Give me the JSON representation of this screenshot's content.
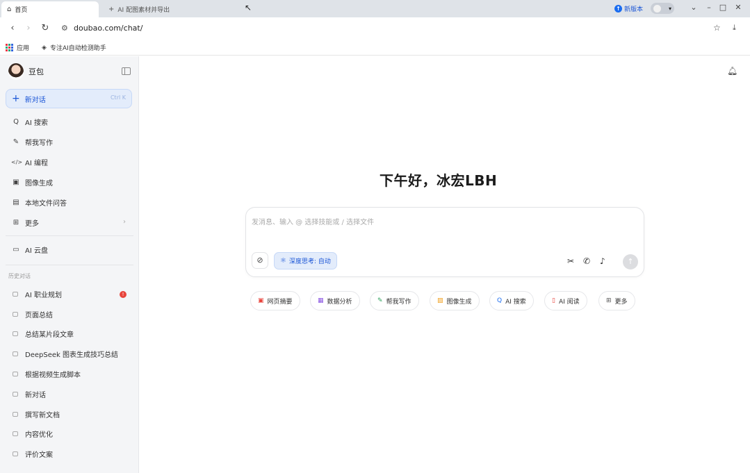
{
  "browser": {
    "active_tab": "首页",
    "inactive_tab": "AI 配图素材并导出",
    "new_version": "新版本",
    "url": "doubao.com/chat/",
    "bookmarks": [
      {
        "label": "应用"
      },
      {
        "label": "专注AI自动检测助手"
      }
    ]
  },
  "sidebar": {
    "brand": "豆包",
    "new_chat": {
      "label": "新对话",
      "shortcut": "Ctrl K"
    },
    "menu": [
      {
        "icon": "ai-search-icon",
        "glyph": "Q",
        "label": "AI 搜索"
      },
      {
        "icon": "write-icon",
        "glyph": "✎",
        "label": "帮我写作"
      },
      {
        "icon": "code-icon",
        "glyph": "</>",
        "label": "AI 编程"
      },
      {
        "icon": "image-gen-icon",
        "glyph": "▣",
        "label": "图像生成"
      },
      {
        "icon": "file-qa-icon",
        "glyph": "▤",
        "label": "本地文件问答"
      },
      {
        "icon": "more-icon",
        "glyph": "⊞",
        "label": "更多"
      }
    ],
    "cloud": {
      "icon": "cloud-drive-icon",
      "glyph": "▭",
      "label": "AI 云盘"
    },
    "history_title": "历史对话",
    "history": [
      {
        "label": "AI 职业规划",
        "badge": "!"
      },
      {
        "label": "页面总结"
      },
      {
        "label": "总结某片段文章"
      },
      {
        "label": "DeepSeek 图表生成技巧总结"
      },
      {
        "label": "根据视频生成脚本"
      },
      {
        "label": "新对话"
      },
      {
        "label": "撰写新文档"
      },
      {
        "label": "内容优化"
      },
      {
        "label": "评价文案"
      }
    ]
  },
  "main": {
    "greeting": "下午好，冰宏LBH",
    "composer": {
      "placeholder": "发消息、输入 @ 选择技能或 / 选择文件",
      "deep_think": "深度思考: 自动"
    },
    "chips": [
      {
        "label": "网页摘要",
        "icon": "web-summary-icon",
        "glyph": "▣",
        "color": "#e8443c"
      },
      {
        "label": "数据分析",
        "icon": "data-analysis-icon",
        "glyph": "▦",
        "color": "#8a56e2"
      },
      {
        "label": "帮我写作",
        "icon": "write-icon",
        "glyph": "✎",
        "color": "#2aa05a"
      },
      {
        "label": "图像生成",
        "icon": "image-gen-icon",
        "glyph": "▨",
        "color": "#f0a020"
      },
      {
        "label": "AI 搜索",
        "icon": "ai-search-icon",
        "glyph": "Q",
        "color": "#1a6cf0"
      },
      {
        "label": "AI 阅读",
        "icon": "ai-read-icon",
        "glyph": "▯",
        "color": "#e8443c"
      },
      {
        "label": "更多",
        "icon": "more-icon",
        "glyph": "⊞",
        "color": "#555555"
      }
    ]
  }
}
